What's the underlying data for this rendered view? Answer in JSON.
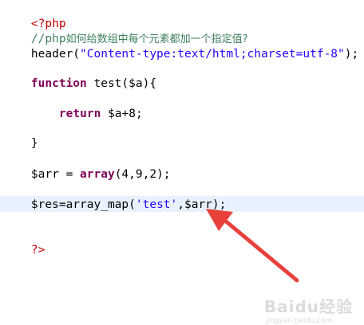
{
  "code": {
    "line1": {
      "tag": "<?php"
    },
    "line2": {
      "comment_prefix": "//php",
      "comment_text": "如何给数组中每个元素都加一个指定值?"
    },
    "line3": {
      "func": "header(",
      "string": "\"Content-type:text/html;charset=utf-8\"",
      "end": ");"
    },
    "line5": {
      "keyword": "function",
      "rest": " test($a){"
    },
    "line7": {
      "keyword": "return",
      "rest": " $a+8;"
    },
    "line9": {
      "text": "}"
    },
    "line11": {
      "var": "$arr = ",
      "keyword": "array",
      "rest": "(4,9,2);"
    },
    "line13": {
      "var": "$res=array_map(",
      "string": "'test'",
      "rest": ",$arr);"
    },
    "line15": {
      "tag": "?>"
    }
  },
  "annotation": {
    "arrow_color": "#e8413c"
  },
  "watermark": {
    "brand": "Baidu经验",
    "sub": "jingyan.baidu.com"
  }
}
